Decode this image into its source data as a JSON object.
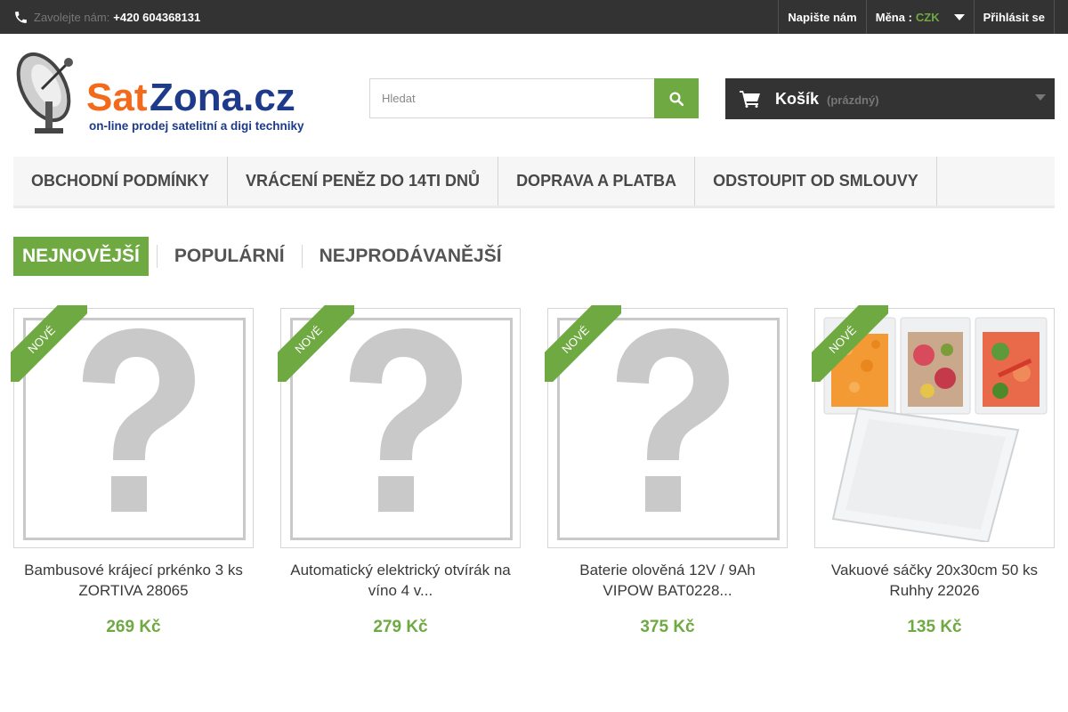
{
  "topbar": {
    "phone_label": "Zavolejte nám:",
    "phone_number": "+420 604368131",
    "contact_label": "Napište nám",
    "currency_label": "Měna :",
    "currency_value": "CZK",
    "login_label": "Přihlásit se",
    "bg_color": "#333333"
  },
  "logo": {
    "brand_part1": "Sat",
    "brand_part2": "Zona.cz",
    "tagline": "on-line prodej satelitní a digi techniky"
  },
  "search": {
    "placeholder": "Hledat"
  },
  "cart": {
    "label": "Košík",
    "status": "(prázdný)"
  },
  "menu": {
    "items": [
      {
        "label": "Obchodní podmínky"
      },
      {
        "label": "Vrácení peněz do 14ti dnů"
      },
      {
        "label": "Doprava a platba"
      },
      {
        "label": "Odstoupit od smlouvy"
      }
    ]
  },
  "tabs": [
    {
      "label": "Nejnovější",
      "active": true
    },
    {
      "label": "Populární",
      "active": false
    },
    {
      "label": "Nejprodávanější",
      "active": false
    }
  ],
  "products": [
    {
      "badge": "Nové",
      "name": "Bambusové krájecí prkénko 3 ks ZORTIVA 28065",
      "price": "269 Kč",
      "image": "question-placeholder"
    },
    {
      "badge": "Nové",
      "name": "Automatický elektrický otvírák na víno 4 v...",
      "price": "279 Kč",
      "image": "question-placeholder"
    },
    {
      "badge": "Nové",
      "name": "Baterie olověná 12V / 9Ah VIPOW BAT0228...",
      "price": "375 Kč",
      "image": "question-placeholder"
    },
    {
      "badge": "Nové",
      "name": "Vakuové sáčky 20x30cm 50 ks Ruhhy 22026",
      "price": "135 Kč",
      "image": "vacuum-bags-photo"
    }
  ],
  "colors": {
    "accent": "#6fa942",
    "dark": "#333333",
    "brand_orange": "#f26b1d",
    "brand_blue": "#1e3a8a"
  }
}
